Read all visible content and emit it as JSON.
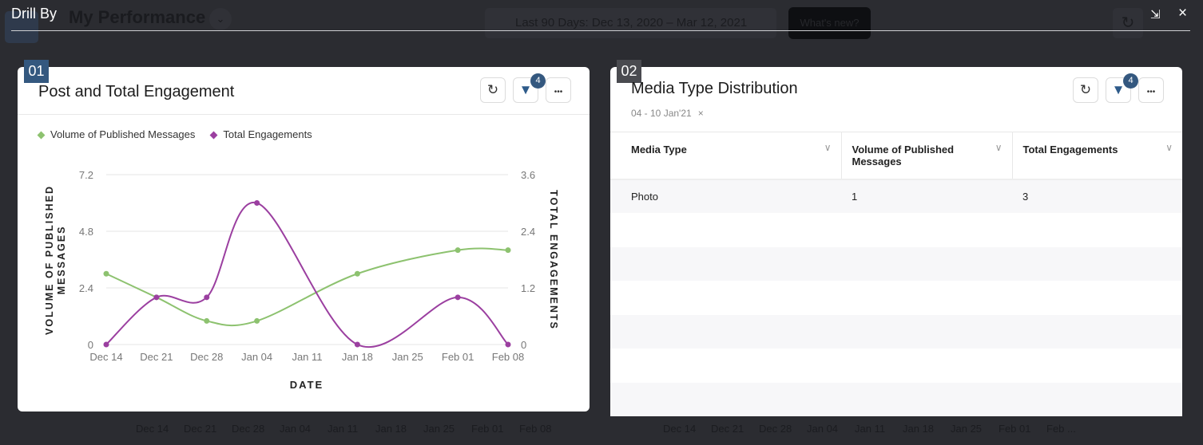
{
  "background": {
    "dashboard_title": "My Performance",
    "date_range": "Last 90 Days: Dec 13, 2020 – Mar 12, 2021",
    "whats_new": "What's new?",
    "axis_labels_left": [
      "Dec 14",
      "Dec 21",
      "Dec 28",
      "Jan 04",
      "Jan 11",
      "Jan 18",
      "Jan 25",
      "Feb 01",
      "Feb 08"
    ],
    "axis_labels_right": [
      "Dec 14",
      "Dec 21",
      "Dec 28",
      "Jan 04",
      "Jan 11",
      "Jan 18",
      "Jan 25",
      "Feb 01",
      "Feb ..."
    ]
  },
  "modal": {
    "title": "Drill By",
    "collapse_icon": "collapse-icon",
    "close_icon": "×"
  },
  "widget1": {
    "number": "01",
    "title": "Post and Total Engagement",
    "filter_count": "4",
    "refresh_icon": "↻",
    "more_icon": "•••"
  },
  "widget2": {
    "number": "02",
    "title": "Media Type Distribution",
    "subtitle": "04 - 10 Jan'21",
    "clear": "×",
    "filter_count": "4",
    "columns": [
      "Media Type",
      "Volume of Published Messages",
      "Total Engagements"
    ],
    "rows": [
      [
        "Photo",
        "1",
        "3"
      ]
    ]
  },
  "chart_data": {
    "type": "line",
    "x": [
      "Dec 14",
      "Dec 21",
      "Dec 28",
      "Jan 04",
      "Jan 11",
      "Jan 18",
      "Jan 25",
      "Feb 01",
      "Feb 08"
    ],
    "xlabel": "DATE",
    "ylabel": "VOLUME OF PUBLISHED MESSAGES",
    "y2label": "TOTAL ENGAGEMENTS",
    "ylim": [
      0,
      7.2
    ],
    "yticks": [
      "0",
      "2.4",
      "4.8",
      "7.2"
    ],
    "y2lim": [
      0,
      3.6
    ],
    "y2ticks": [
      "0",
      "1.2",
      "2.4",
      "3.6"
    ],
    "grid": true,
    "legend": "top-left",
    "series": [
      {
        "name": "Volume of Published Messages",
        "axis": "left",
        "color": "#8dc26f",
        "values": [
          3,
          2,
          1,
          1,
          null,
          3,
          null,
          4,
          4
        ]
      },
      {
        "name": "Total Engagements",
        "axis": "right",
        "color": "#9b3fa0",
        "values": [
          0,
          1,
          1,
          3,
          null,
          0,
          null,
          1,
          0
        ]
      }
    ]
  }
}
